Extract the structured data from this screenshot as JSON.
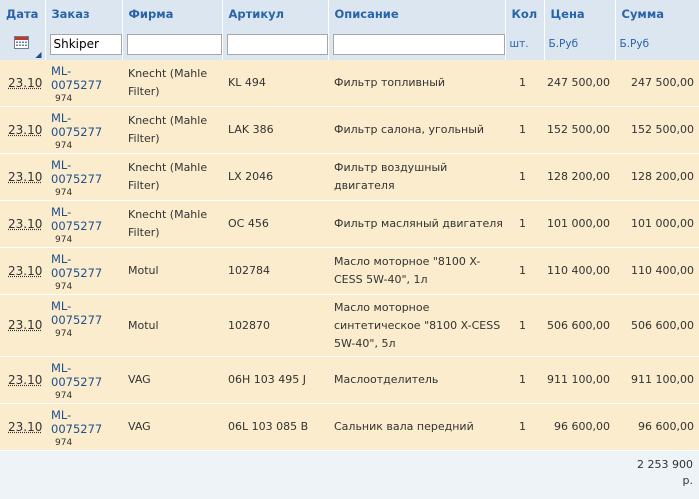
{
  "headers": {
    "date": "Дата",
    "order": "Заказ",
    "firm": "Фирма",
    "article": "Артикул",
    "description": "Описание",
    "qty": "Кол",
    "price": "Цена",
    "sum": "Сумма"
  },
  "units": {
    "qty": "шт.",
    "price": "Б.Руб",
    "sum": "Б.Руб"
  },
  "filters": {
    "order_value": "Shkiper",
    "firm_value": "",
    "article_value": "",
    "description_value": ""
  },
  "icons": {
    "calendar": "calendar-icon",
    "sort": "sort-arrow-icon"
  },
  "rows": [
    {
      "date": "23.10",
      "order": "ML-0075277",
      "order_sub": "974",
      "firm": "Knecht (Mahle Filter)",
      "article": "KL 494",
      "description": "Фильтр топливный",
      "qty": "1",
      "price": "247 500,00",
      "sum": "247 500,00"
    },
    {
      "date": "23.10",
      "order": "ML-0075277",
      "order_sub": "974",
      "firm": "Knecht (Mahle Filter)",
      "article": "LAK 386",
      "description": "Фильтр салона, угольный",
      "qty": "1",
      "price": "152 500,00",
      "sum": "152 500,00"
    },
    {
      "date": "23.10",
      "order": "ML-0075277",
      "order_sub": "974",
      "firm": "Knecht (Mahle Filter)",
      "article": "LX 2046",
      "description": "Фильтр воздушный двигателя",
      "qty": "1",
      "price": "128 200,00",
      "sum": "128 200,00"
    },
    {
      "date": "23.10",
      "order": "ML-0075277",
      "order_sub": "974",
      "firm": "Knecht (Mahle Filter)",
      "article": "OC 456",
      "description": "Фильтр масляный двигателя",
      "qty": "1",
      "price": "101 000,00",
      "sum": "101 000,00"
    },
    {
      "date": "23.10",
      "order": "ML-0075277",
      "order_sub": "974",
      "firm": "Motul",
      "article": "102784",
      "description": "Масло моторное \"8100 X-CESS 5W-40\", 1л",
      "qty": "1",
      "price": "110 400,00",
      "sum": "110 400,00"
    },
    {
      "date": "23.10",
      "order": "ML-0075277",
      "order_sub": "974",
      "firm": "Motul",
      "article": "102870",
      "description": "Масло моторное синтетическое \"8100 X-CESS 5W-40\", 5л",
      "qty": "1",
      "price": "506 600,00",
      "sum": "506 600,00"
    },
    {
      "date": "23.10",
      "order": "ML-0075277",
      "order_sub": "974",
      "firm": "VAG",
      "article": "06H 103 495 J",
      "description": "Маслоотделитель",
      "qty": "1",
      "price": "911 100,00",
      "sum": "911 100,00"
    },
    {
      "date": "23.10",
      "order": "ML-0075277",
      "order_sub": "974",
      "firm": "VAG",
      "article": "06L 103 085 B",
      "description": "Сальник вала передний",
      "qty": "1",
      "price": "96 600,00",
      "sum": "96 600,00"
    }
  ],
  "total": {
    "value": "2 253 900",
    "currency": "р."
  },
  "colors": {
    "header_bg": "#dce6f0",
    "header_text": "#2a64a8",
    "row_bg": "#faeccd",
    "link": "#1f4f8d"
  }
}
